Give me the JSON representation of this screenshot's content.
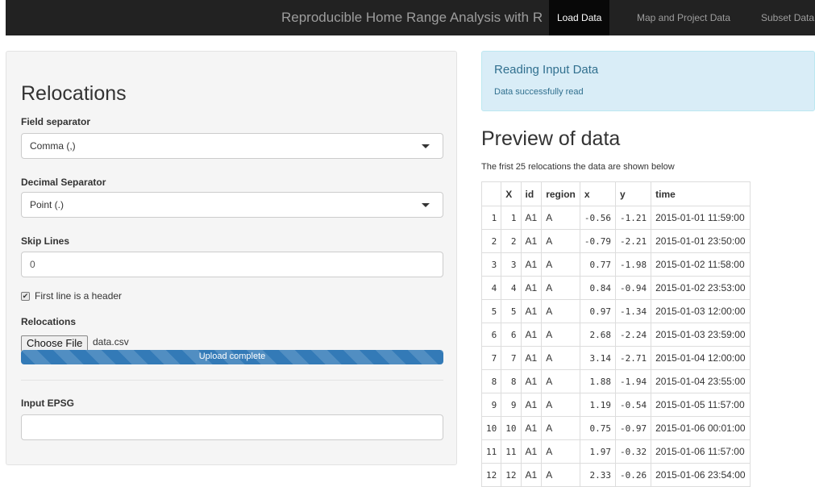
{
  "navbar": {
    "brand": "Reproducible Home Range Analysis with R",
    "tabs": [
      "Load Data",
      "Map and Project Data",
      "Subset Data"
    ],
    "active_tab": "Load Data"
  },
  "sidebar": {
    "title": "Relocations",
    "field_separator": {
      "label": "Field separator",
      "value": "Comma (,)"
    },
    "decimal_separator": {
      "label": "Decimal Separator",
      "value": "Point (.)"
    },
    "skip_lines": {
      "label": "Skip Lines",
      "value": "0"
    },
    "header_checkbox": {
      "label": "First line is a header",
      "checked": true,
      "check_glyph": "✔"
    },
    "relocations_file": {
      "label": "Relocations",
      "button": "Choose File",
      "file_name": "data.csv",
      "progress_text": "Upload complete",
      "progress": 1.0
    },
    "input_epsg": {
      "label": "Input EPSG",
      "value": ""
    }
  },
  "alert": {
    "title": "Reading Input Data",
    "message": "Data successfully read"
  },
  "preview": {
    "title": "Preview of data",
    "subtitle": "The frist 25 relocations the data are shown below",
    "columns": [
      "",
      "X",
      "id",
      "region",
      "x",
      "y",
      "time"
    ],
    "rows": [
      [
        "1",
        "1",
        "A1",
        "A",
        "-0.56",
        "-1.21",
        "2015-01-01 11:59:00"
      ],
      [
        "2",
        "2",
        "A1",
        "A",
        "-0.79",
        "-2.21",
        "2015-01-01 23:50:00"
      ],
      [
        "3",
        "3",
        "A1",
        "A",
        "0.77",
        "-1.98",
        "2015-01-02 11:58:00"
      ],
      [
        "4",
        "4",
        "A1",
        "A",
        "0.84",
        "-0.94",
        "2015-01-02 23:53:00"
      ],
      [
        "5",
        "5",
        "A1",
        "A",
        "0.97",
        "-1.34",
        "2015-01-03 12:00:00"
      ],
      [
        "6",
        "6",
        "A1",
        "A",
        "2.68",
        "-2.24",
        "2015-01-03 23:59:00"
      ],
      [
        "7",
        "7",
        "A1",
        "A",
        "3.14",
        "-2.71",
        "2015-01-04 12:00:00"
      ],
      [
        "8",
        "8",
        "A1",
        "A",
        "1.88",
        "-1.94",
        "2015-01-04 23:55:00"
      ],
      [
        "9",
        "9",
        "A1",
        "A",
        "1.19",
        "-0.54",
        "2015-01-05 11:57:00"
      ],
      [
        "10",
        "10",
        "A1",
        "A",
        "0.75",
        "-0.97",
        "2015-01-06 00:01:00"
      ],
      [
        "11",
        "11",
        "A1",
        "A",
        "1.97",
        "-0.32",
        "2015-01-06 11:57:00"
      ],
      [
        "12",
        "12",
        "A1",
        "A",
        "2.33",
        "-0.26",
        "2015-01-06 23:54:00"
      ]
    ]
  },
  "colors": {
    "navbar": "#222222",
    "alert_bg": "#d9edf7",
    "alert_text": "#31708f",
    "progress": "#337ab7"
  }
}
